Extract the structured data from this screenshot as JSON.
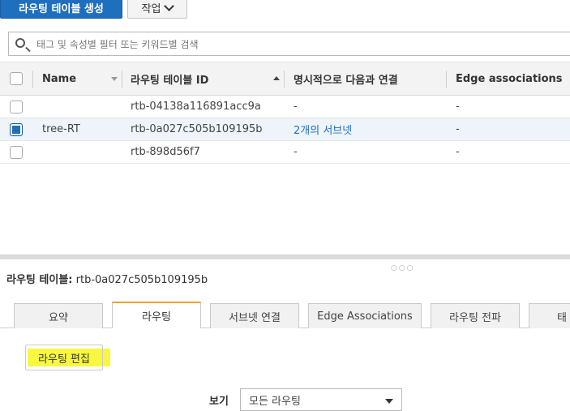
{
  "toolbar": {
    "create_label": "라우팅 테이블 생성",
    "actions_label": "작업"
  },
  "search": {
    "placeholder": "태그 및 속성별 필터 또는 키워드별 검색"
  },
  "table": {
    "columns": [
      "Name",
      "라우팅 테이블 ID",
      "명시적으로 다음과 연결",
      "Edge associations"
    ],
    "rows": [
      {
        "name": "",
        "id": "rtb-04138a116891acc9a",
        "explicit": "-",
        "edge": "-",
        "selected": false
      },
      {
        "name": "tree-RT",
        "id": "rtb-0a027c505b109195b",
        "explicit": "2개의 서브넷",
        "edge": "-",
        "selected": true
      },
      {
        "name": "",
        "id": "rtb-898d56f7",
        "explicit": "-",
        "edge": "-",
        "selected": false
      }
    ]
  },
  "detail": {
    "title_prefix": "라우팅 테이블:",
    "title_value": "rtb-0a027c505b109195b"
  },
  "tabs": [
    "요약",
    "라우팅",
    "서브넷 연결",
    "Edge Associations",
    "라우팅 전파",
    "태"
  ],
  "active_tab": "라우팅",
  "routes": {
    "edit_label": "라우팅 편집",
    "view_label": "보기",
    "view_value": "모든 라우팅"
  },
  "colors": {
    "primary": "#1f6fbf",
    "tab_accent": "#f0a12a",
    "highlight": "#f6f600"
  }
}
